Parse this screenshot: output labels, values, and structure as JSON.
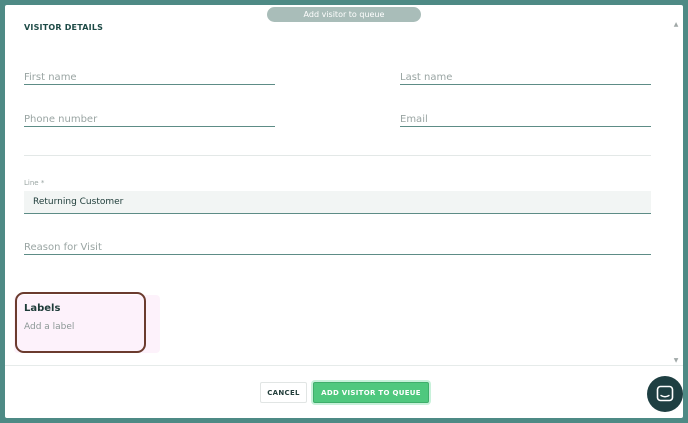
{
  "modal": {
    "banner": "Add visitor to queue",
    "section_title": "VISITOR DETAILS"
  },
  "form": {
    "first_name": {
      "placeholder": "First name",
      "value": ""
    },
    "last_name": {
      "placeholder": "Last name",
      "value": ""
    },
    "phone": {
      "placeholder": "Phone number",
      "value": ""
    },
    "email": {
      "placeholder": "Email",
      "value": ""
    },
    "line": {
      "label": "Line *",
      "value": "Returning Customer"
    },
    "reason": {
      "placeholder": "Reason for Visit",
      "value": ""
    }
  },
  "labels": {
    "title": "Labels",
    "add": "Add a label"
  },
  "footer": {
    "cancel_label": "CANCEL",
    "add_label": "ADD VISITOR TO QUEUE"
  },
  "colors": {
    "backdrop": "#4e8a85",
    "accent": "#4fc87e",
    "launcher": "#1e3f42",
    "highlight_border": "#6b3b2e"
  },
  "icons": {
    "scroll_up": "▲",
    "scroll_down": "▼",
    "chat": "chat-icon"
  }
}
